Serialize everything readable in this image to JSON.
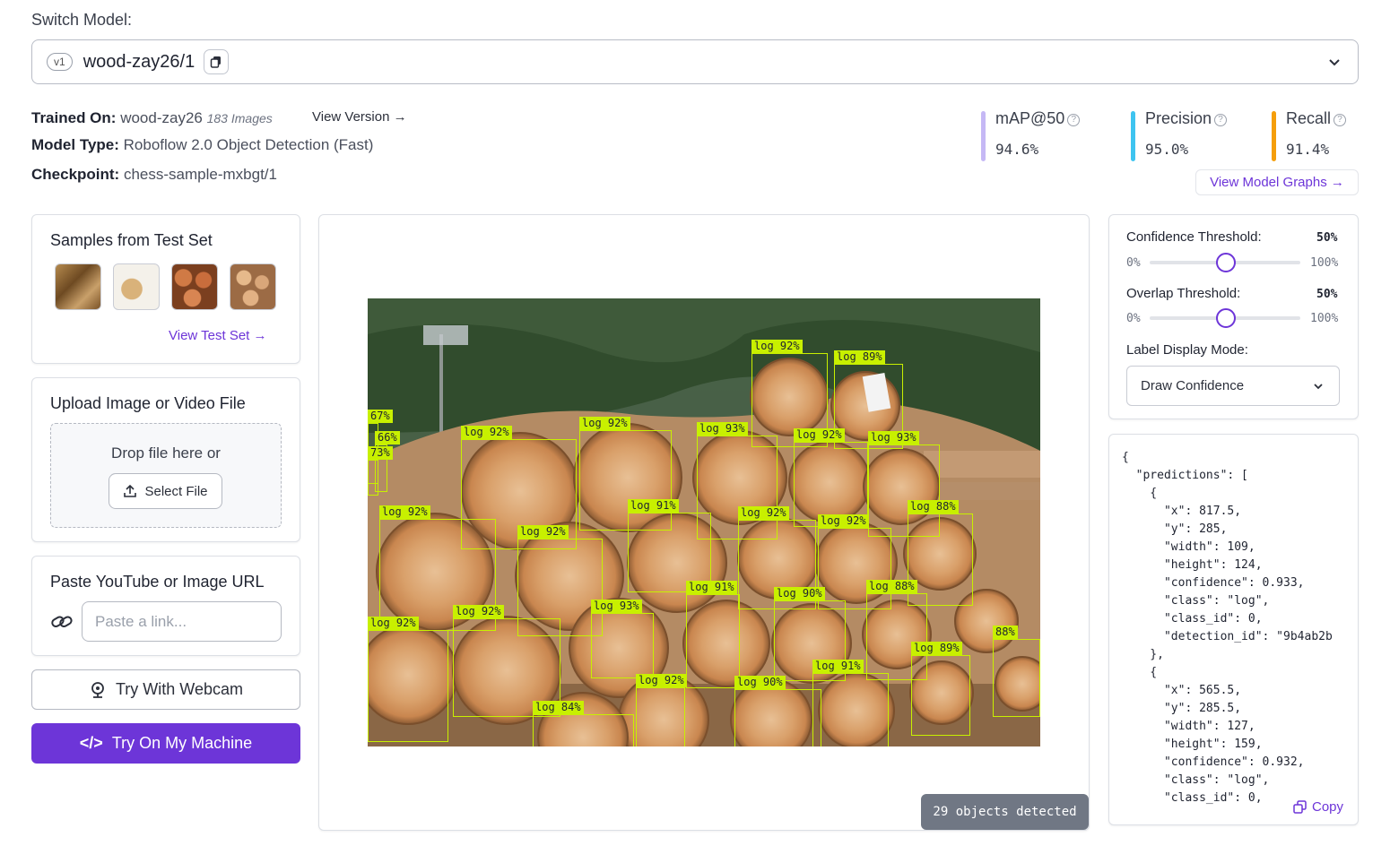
{
  "switch_model_label": "Switch Model:",
  "model": {
    "version_badge": "v1",
    "name": "wood-zay26/1"
  },
  "info": {
    "trained_on_label": "Trained On:",
    "trained_on_value": "wood-zay26",
    "image_count": "183 Images",
    "view_version": "View Version",
    "model_type_label": "Model Type:",
    "model_type_value": "Roboflow 2.0 Object Detection (Fast)",
    "checkpoint_label": "Checkpoint:",
    "checkpoint_value": "chess-sample-mxbgt/1"
  },
  "metrics": [
    {
      "name": "mAP@50",
      "value": "94.6%",
      "color": "#c5b8f5"
    },
    {
      "name": "Precision",
      "value": "95.0%",
      "color": "#3ec4f0"
    },
    {
      "name": "Recall",
      "value": "91.4%",
      "color": "#f59e0b"
    }
  ],
  "view_model_graphs": "View Model Graphs",
  "samples": {
    "title": "Samples from Test Set",
    "view_test_set": "View Test Set"
  },
  "upload": {
    "title": "Upload Image or Video File",
    "drop_text": "Drop file here or",
    "select_file": "Select File"
  },
  "url": {
    "title": "Paste YouTube or Image URL",
    "placeholder": "Paste a link..."
  },
  "webcam_button": "Try With Webcam",
  "machine_button": "Try On My Machine",
  "objects_detected": "29 objects detected",
  "settings": {
    "confidence_label": "Confidence Threshold:",
    "confidence_value": "50%",
    "overlap_label": "Overlap Threshold:",
    "overlap_value": "50%",
    "min_label": "0%",
    "max_label": "100%",
    "display_mode_label": "Label Display Mode:",
    "display_mode_value": "Draw Confidence"
  },
  "json_output": "{\n  \"predictions\": [\n    {\n      \"x\": 817.5,\n      \"y\": 285,\n      \"width\": 109,\n      \"height\": 124,\n      \"confidence\": 0.933,\n      \"class\": \"log\",\n      \"class_id\": 0,\n      \"detection_id\": \"9b4ab2b\n    },\n    {\n      \"x\": 565.5,\n      \"y\": 285.5,\n      \"width\": 127,\n      \"height\": 159,\n      \"confidence\": 0.932,\n      \"class\": \"log\",\n      \"class_id\": 0,",
  "copy_label": "Copy",
  "detections": [
    {
      "label": "log 92%"
    },
    {
      "label": "log 89%"
    },
    {
      "label": "67%"
    },
    {
      "label": "66%"
    },
    {
      "label": "73%"
    },
    {
      "label": "log 92%"
    },
    {
      "label": "log 92%"
    },
    {
      "label": "log 93%"
    },
    {
      "label": "log 92%"
    },
    {
      "label": "log 93%"
    },
    {
      "label": "log 91%"
    },
    {
      "label": "log 92%"
    },
    {
      "label": "log 92%"
    },
    {
      "label": "log 92%"
    },
    {
      "label": "log 92%"
    },
    {
      "label": "log 88%"
    },
    {
      "label": "log 91%"
    },
    {
      "label": "log 90%"
    },
    {
      "label": "log 88%"
    },
    {
      "label": "log 93%"
    },
    {
      "label": "log 92%"
    },
    {
      "label": "log 92%"
    },
    {
      "label": "log 89%"
    },
    {
      "label": "88%"
    },
    {
      "label": "log 91%"
    },
    {
      "label": "log 92%"
    },
    {
      "label": "log 90%"
    },
    {
      "label": "log 84%"
    },
    {
      "label": "log 92%"
    }
  ],
  "colors": {
    "accent": "#6d35d8",
    "box": "#c8f000"
  }
}
